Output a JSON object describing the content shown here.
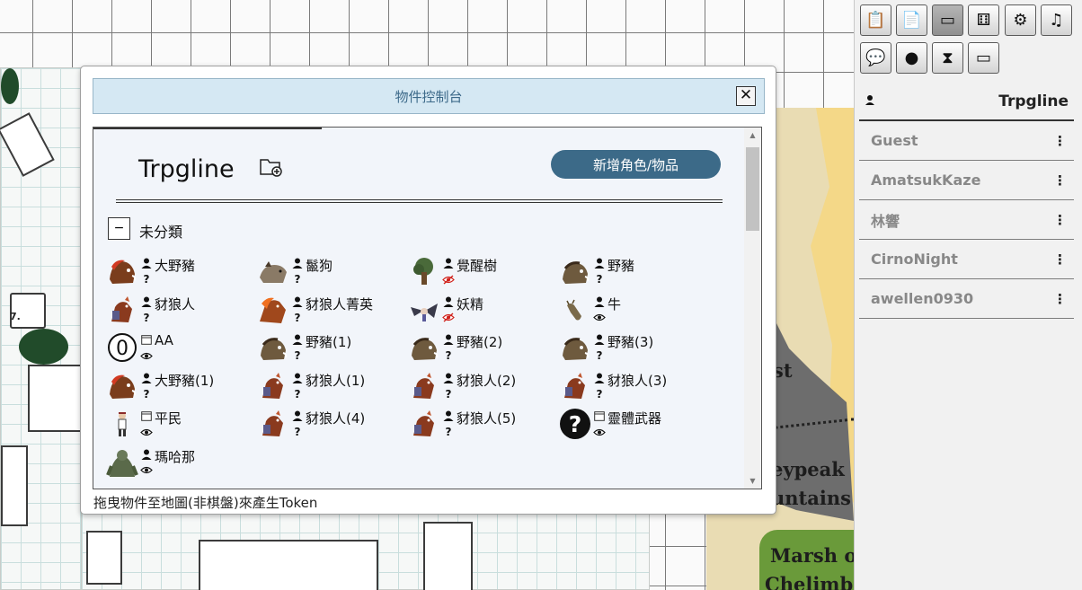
{
  "map": {
    "region_labels": [
      "st",
      "eypeak",
      "untains",
      "Marsh of",
      "Chelimber"
    ],
    "room_number": "7."
  },
  "toolbar": {
    "buttons": [
      {
        "icon": "clipboard-check-icon",
        "glyph": "📋"
      },
      {
        "icon": "clipboard-lock-icon",
        "glyph": "📄"
      },
      {
        "icon": "archive-box-icon",
        "glyph": "▭",
        "active": true
      },
      {
        "icon": "dice-icon",
        "glyph": "⚅"
      },
      {
        "icon": "gear-icon",
        "glyph": "⚙"
      },
      {
        "icon": "music-note-icon",
        "glyph": "♫"
      },
      {
        "icon": "chat-bubbles-icon",
        "glyph": "💬"
      },
      {
        "icon": "user-silhouette-icon",
        "glyph": "●"
      },
      {
        "icon": "hourglass-icon",
        "glyph": "⧗"
      },
      {
        "icon": "presentation-board-icon",
        "glyph": "▭"
      }
    ]
  },
  "users": {
    "self": {
      "name": "Trpgline",
      "icon": "person-icon"
    },
    "others": [
      {
        "name": "Guest"
      },
      {
        "name": "AmatsukKaze"
      },
      {
        "name": "林響"
      },
      {
        "name": "CirnoNight"
      },
      {
        "name": "awellen0930"
      }
    ],
    "menu_glyph": "⋮"
  },
  "dialog": {
    "title": "物件控制台",
    "close_glyph": "✕",
    "owner": "Trpgline",
    "add_button": "新增角色/物品",
    "category": {
      "toggle": "−",
      "name": "未分類"
    },
    "hint": "拖曳物件至地圖(非棋盤)來產生Token",
    "items": [
      {
        "name": "大野豬",
        "avatar": "boar-red",
        "type": "person",
        "vis": "?"
      },
      {
        "name": "鬣狗",
        "avatar": "hyena",
        "type": "person",
        "vis": "?"
      },
      {
        "name": "覺醒樹",
        "avatar": "tree",
        "type": "person",
        "vis": "hidden-eye"
      },
      {
        "name": "野豬",
        "avatar": "boar",
        "type": "person",
        "vis": "?"
      },
      {
        "name": "豺狼人",
        "avatar": "gnoll",
        "type": "person",
        "vis": "?"
      },
      {
        "name": "豺狼人菁英",
        "avatar": "gnoll-elite",
        "type": "person",
        "vis": "?"
      },
      {
        "name": "妖精",
        "avatar": "fairy",
        "type": "person",
        "vis": "hidden-eye"
      },
      {
        "name": "牛",
        "avatar": "cow",
        "type": "person",
        "vis": "eye"
      },
      {
        "name": "AA",
        "avatar": "zero-circle",
        "type": "box",
        "vis": "eye"
      },
      {
        "name": "野豬(1)",
        "avatar": "boar",
        "type": "person",
        "vis": "?"
      },
      {
        "name": "野豬(2)",
        "avatar": "boar",
        "type": "person",
        "vis": "?"
      },
      {
        "name": "野豬(3)",
        "avatar": "boar",
        "type": "person",
        "vis": "?"
      },
      {
        "name": "大野豬(1)",
        "avatar": "boar-red",
        "type": "person",
        "vis": "?"
      },
      {
        "name": "豺狼人(1)",
        "avatar": "gnoll",
        "type": "person",
        "vis": "?"
      },
      {
        "name": "豺狼人(2)",
        "avatar": "gnoll",
        "type": "person",
        "vis": "?"
      },
      {
        "name": "豺狼人(3)",
        "avatar": "gnoll",
        "type": "person",
        "vis": "?"
      },
      {
        "name": "平民",
        "avatar": "commoner",
        "type": "box",
        "vis": "eye"
      },
      {
        "name": "豺狼人(4)",
        "avatar": "gnoll",
        "type": "person",
        "vis": "?"
      },
      {
        "name": "豺狼人(5)",
        "avatar": "gnoll",
        "type": "person",
        "vis": "?"
      },
      {
        "name": "靈體武器",
        "avatar": "question-circle",
        "type": "box",
        "vis": "eye"
      },
      {
        "name": "瑪哈那",
        "avatar": "troll",
        "type": "person",
        "vis": "eye"
      }
    ]
  }
}
